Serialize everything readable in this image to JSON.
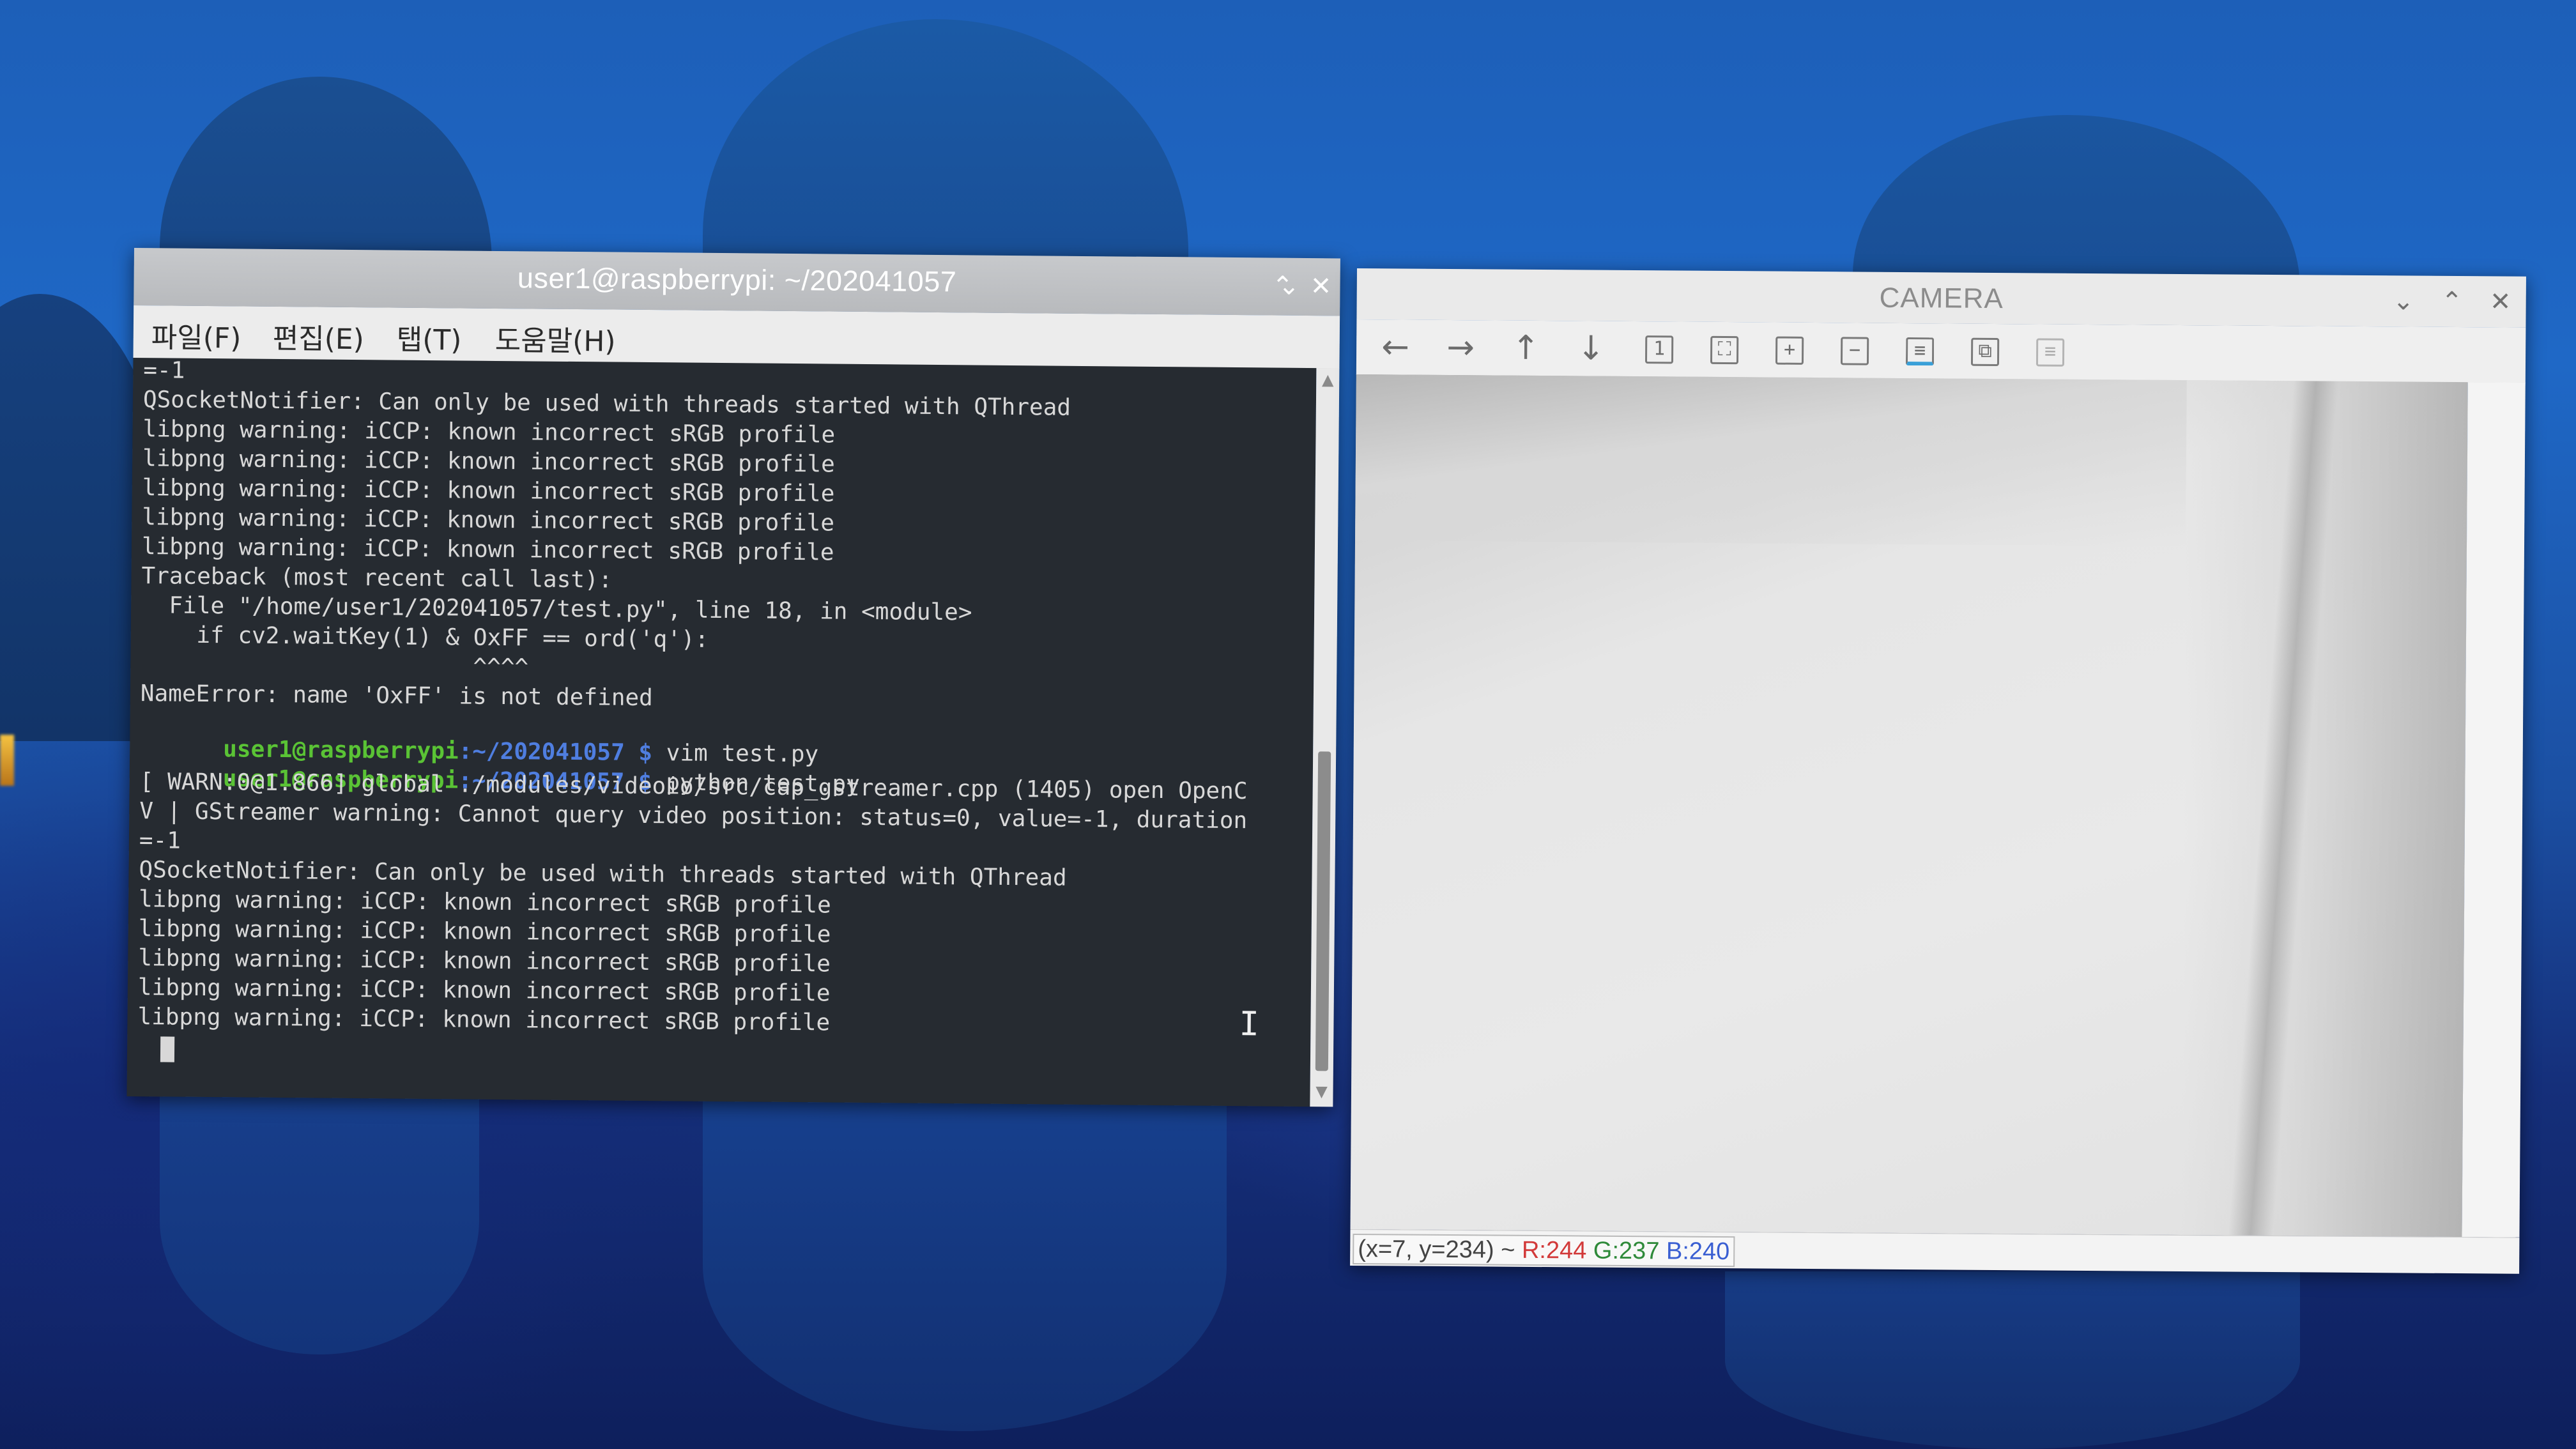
{
  "terminal": {
    "title": "user1@raspberrypi: ~/202041057",
    "menu": [
      "파일(F)",
      "편집(E)",
      "탭(T)",
      "도움말(H)"
    ],
    "window_buttons": {
      "minimize": "⌄",
      "maximize": "⌃",
      "close": "✕"
    },
    "lines": [
      {
        "text": "=-1"
      },
      {
        "text": "QSocketNotifier: Can only be used with threads started with QThread"
      },
      {
        "text": "libpng warning: iCCP: known incorrect sRGB profile"
      },
      {
        "text": "libpng warning: iCCP: known incorrect sRGB profile"
      },
      {
        "text": "libpng warning: iCCP: known incorrect sRGB profile"
      },
      {
        "text": "libpng warning: iCCP: known incorrect sRGB profile"
      },
      {
        "text": "libpng warning: iCCP: known incorrect sRGB profile"
      },
      {
        "text": "Traceback (most recent call last):"
      },
      {
        "text": "  File \"/home/user1/202041057/test.py\", line 18, in <module>"
      },
      {
        "text": "    if cv2.waitKey(1) & OxFF == ord('q'):"
      },
      {
        "text": "                        ^^^^"
      },
      {
        "text": "NameError: name 'OxFF' is not defined"
      },
      {
        "prompt_user": "user1@raspberrypi",
        "prompt_path": ":~/202041057 $",
        "command": " vim test.py"
      },
      {
        "prompt_user": "user1@raspberrypi",
        "prompt_path": ":~/202041057 $",
        "command": " python test.py"
      },
      {
        "text": "[ WARN:0@1.866] global ./modules/videoio/src/cap_gstreamer.cpp (1405) open OpenC"
      },
      {
        "text": "V | GStreamer warning: Cannot query video position: status=0, value=-1, duration"
      },
      {
        "text": "=-1"
      },
      {
        "text": "QSocketNotifier: Can only be used with threads started with QThread"
      },
      {
        "text": "libpng warning: iCCP: known incorrect sRGB profile"
      },
      {
        "text": "libpng warning: iCCP: known incorrect sRGB profile"
      },
      {
        "text": "libpng warning: iCCP: known incorrect sRGB profile"
      },
      {
        "text": "libpng warning: iCCP: known incorrect sRGB profile"
      },
      {
        "text": "libpng warning: iCCP: known incorrect sRGB profile"
      }
    ],
    "colors": {
      "background": "#262b31",
      "prompt_user": "#5ac335",
      "prompt_path": "#4f7ee0",
      "text": "#d8d8d8"
    }
  },
  "camera": {
    "title": "CAMERA",
    "window_buttons": {
      "minimize": "⌄",
      "maximize": "⌃",
      "close": "✕"
    },
    "toolbar": [
      {
        "icon": "arrow-left-icon",
        "glyph": "←"
      },
      {
        "icon": "arrow-right-icon",
        "glyph": "→"
      },
      {
        "icon": "arrow-up-icon",
        "glyph": "↑"
      },
      {
        "icon": "arrow-down-icon",
        "glyph": "↓"
      },
      {
        "icon": "zoom-original-icon",
        "glyph": "1"
      },
      {
        "icon": "zoom-fit-icon",
        "glyph": "⛶"
      },
      {
        "icon": "zoom-in-icon",
        "glyph": "+"
      },
      {
        "icon": "zoom-out-icon",
        "glyph": "−"
      },
      {
        "icon": "save-image-icon",
        "glyph": "≡"
      },
      {
        "icon": "copy-image-icon",
        "glyph": "⧉"
      },
      {
        "icon": "properties-icon",
        "glyph": "≡"
      }
    ],
    "status": {
      "coord": "(x=7, y=234) ~",
      "r": " R:244",
      "g": " G:237",
      "b": " B:240"
    }
  }
}
